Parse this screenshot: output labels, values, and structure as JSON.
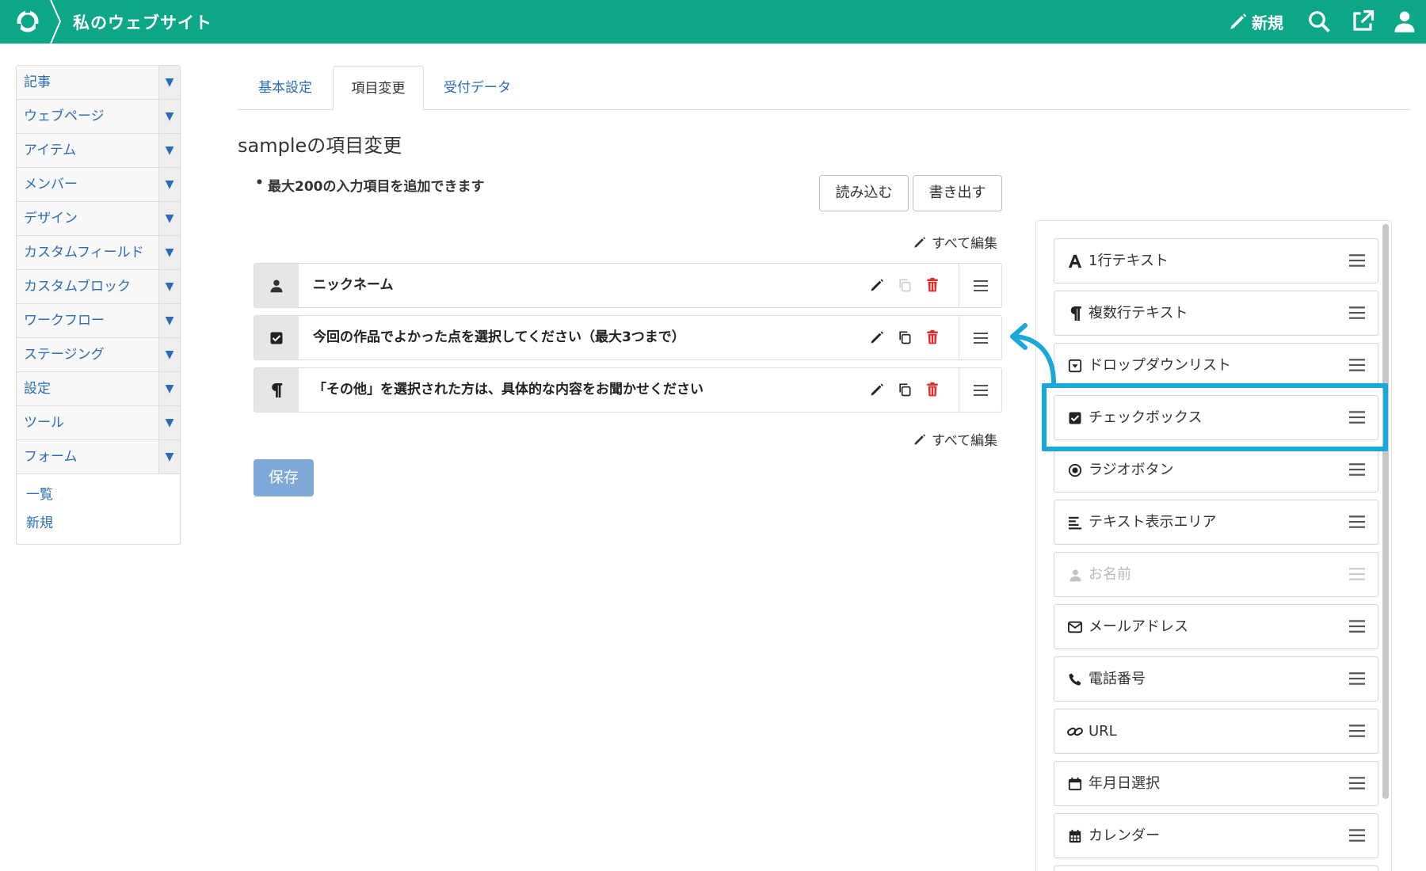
{
  "header": {
    "site_title": "私のウェブサイト",
    "new_label": "新規",
    "icons": [
      "logo-icon",
      "pencil-icon",
      "search-icon",
      "external-link-icon",
      "user-icon"
    ]
  },
  "sidebar": {
    "items": [
      {
        "label": "記事"
      },
      {
        "label": "ウェブページ"
      },
      {
        "label": "アイテム"
      },
      {
        "label": "メンバー"
      },
      {
        "label": "デザイン"
      },
      {
        "label": "カスタムフィールド"
      },
      {
        "label": "カスタムブロック"
      },
      {
        "label": "ワークフロー"
      },
      {
        "label": "ステージング"
      },
      {
        "label": "設定"
      },
      {
        "label": "ツール"
      },
      {
        "label": "フォーム"
      }
    ],
    "arrow": "▼",
    "sub_items": [
      {
        "label": "一覧"
      },
      {
        "label": "新規"
      }
    ]
  },
  "tabs": [
    {
      "label": "基本設定",
      "active": false
    },
    {
      "label": "項目変更",
      "active": true
    },
    {
      "label": "受付データ",
      "active": false
    }
  ],
  "main": {
    "page_title": "sampleの項目変更",
    "notice": "最大200の入力項目を追加できます",
    "import_label": "読み込む",
    "export_label": "書き出す",
    "edit_all_label": "すべて編集",
    "save_label": "保存"
  },
  "fields": [
    {
      "name": "ニックネーム",
      "icon": "user-icon",
      "copy_enabled": false
    },
    {
      "name": "今回の作品でよかった点を選択してください（最大3つまで）",
      "icon": "checkbox-icon",
      "copy_enabled": true
    },
    {
      "name": "「その他」を選択された方は、具体的な内容をお聞かせください",
      "icon": "paragraph-icon",
      "copy_enabled": true
    }
  ],
  "palette": [
    {
      "label": "1行テキスト",
      "icon": "font-icon",
      "disabled": false
    },
    {
      "label": "複数行テキスト",
      "icon": "paragraph-icon",
      "disabled": false
    },
    {
      "label": "ドロップダウンリスト",
      "icon": "dropdown-icon",
      "disabled": false
    },
    {
      "label": "チェックボックス",
      "icon": "checkbox-icon",
      "disabled": false,
      "highlighted": true
    },
    {
      "label": "ラジオボタン",
      "icon": "radio-icon",
      "disabled": false
    },
    {
      "label": "テキスト表示エリア",
      "icon": "align-left-icon",
      "disabled": false
    },
    {
      "label": "お名前",
      "icon": "user-icon",
      "disabled": true
    },
    {
      "label": "メールアドレス",
      "icon": "envelope-icon",
      "disabled": false
    },
    {
      "label": "電話番号",
      "icon": "phone-icon",
      "disabled": false
    },
    {
      "label": "URL",
      "icon": "link-icon",
      "disabled": false
    },
    {
      "label": "年月日選択",
      "icon": "calendar-icon",
      "disabled": false
    },
    {
      "label": "カレンダー",
      "icon": "calendar-grid-icon",
      "disabled": false
    }
  ],
  "colors": {
    "header": "#0ca688",
    "link": "#2a6db5",
    "delete": "#e02a2a",
    "highlight": "#19a8dc",
    "save": "#7fa7d8"
  }
}
